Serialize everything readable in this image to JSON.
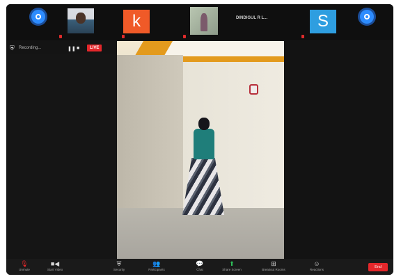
{
  "strip": {
    "tile1_label": "",
    "tile2_label": "",
    "tile3_label": "",
    "tile4_label": "",
    "tile5_label": "",
    "tile6_label": "",
    "tile7_label": "",
    "center_name": "DINDIGUL R L...",
    "tile3_letter": "k",
    "tile6_letter": "S",
    "tile3_color": "#f05a28",
    "tile6_color": "#2e9ee0"
  },
  "recording": {
    "label": "Recording...",
    "pause_icon": "pause-icon",
    "stop_icon": "stop-icon",
    "live_badge": "LIVE",
    "live_text": ""
  },
  "side_caption": "",
  "toolbar": {
    "items": [
      {
        "label": "Unmute",
        "icon": "mic-off-icon"
      },
      {
        "label": "Start Video",
        "icon": "video-icon"
      },
      {
        "label": "Security",
        "icon": "shield-icon"
      },
      {
        "label": "Participants",
        "icon": "participants-icon"
      },
      {
        "label": "Chat",
        "icon": "chat-icon"
      },
      {
        "label": "Share Screen",
        "icon": "share-screen-icon"
      },
      {
        "label": "Breakout Rooms",
        "icon": "breakout-rooms-icon"
      },
      {
        "label": "Reactions",
        "icon": "reactions-icon"
      }
    ],
    "end_label": "End"
  }
}
